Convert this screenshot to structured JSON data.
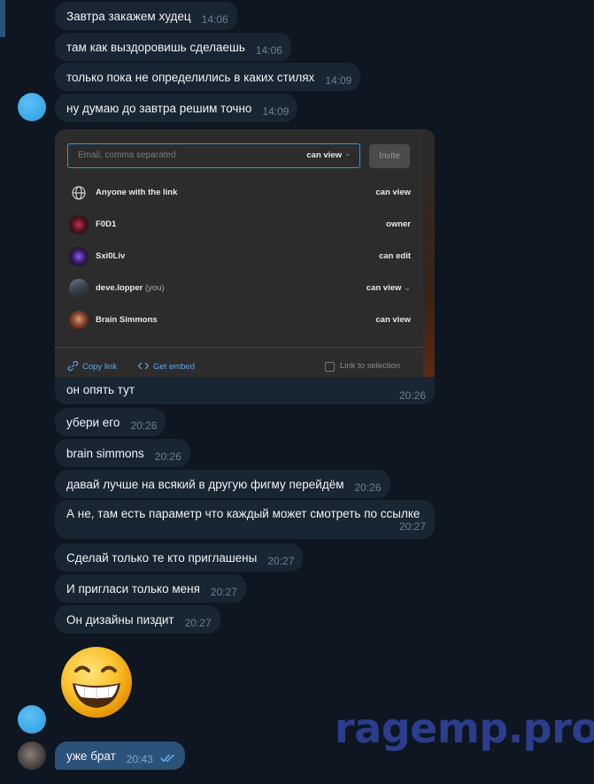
{
  "messages": [
    {
      "text": "Завтра закажем худец",
      "time": "14:06"
    },
    {
      "text": "там как выздоровишь сделаешь",
      "time": "14:06"
    },
    {
      "text": "только пока не определились в каких стилях",
      "time": "14:09"
    },
    {
      "text": "ну думаю до завтра решим точно",
      "time": "14:09"
    },
    {
      "text": "он опять тут",
      "time": "20:26"
    },
    {
      "text": "убери его",
      "time": "20:26"
    },
    {
      "text": "brain simmons",
      "time": "20:26"
    },
    {
      "text": "давай лучше на всякий в другую фигму перейдём",
      "time": "20:26"
    },
    {
      "text": "А не, там есть параметр что каждый может смотреть по ссылке",
      "time": "20:27"
    },
    {
      "text": "Сделай только те кто приглашены",
      "time": "20:27"
    },
    {
      "text": "И пригласи только меня",
      "time": "20:27"
    },
    {
      "text": "Он дизайны пиздит",
      "time": "20:27"
    },
    {
      "text": "уже брат",
      "time": "20:43"
    }
  ],
  "share_screenshot": {
    "input_placeholder": "Email, comma separated",
    "input_permission": "can view",
    "invite_label": "Invite",
    "rows": [
      {
        "name": "Anyone with the link",
        "you": "",
        "permission": "can view",
        "icon": "globe-icon"
      },
      {
        "name": "F0D1",
        "you": "",
        "permission": "owner",
        "icon": "avatar-red"
      },
      {
        "name": "Sxi0Liv",
        "you": "",
        "permission": "can edit",
        "icon": "avatar-purple"
      },
      {
        "name": "deve.lopper",
        "you": "(you)",
        "permission": "can view",
        "icon": "avatar-car"
      },
      {
        "name": "Brain Simmons",
        "you": "",
        "permission": "can view",
        "icon": "avatar-photo"
      }
    ],
    "copy_link": "Copy link",
    "get_embed": "Get embed",
    "link_to_selection": "Link to selection"
  },
  "watermark": "ragemp.pro",
  "colors": {
    "bg": "#0e1621",
    "incoming": "#182533",
    "outgoing": "#2b5278",
    "accent": "#18a0fb"
  }
}
